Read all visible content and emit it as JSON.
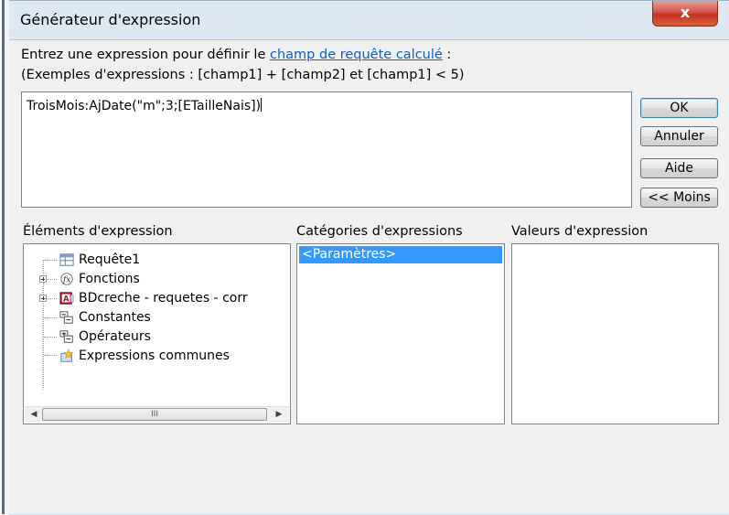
{
  "window": {
    "title": "Générateur d'expression",
    "close_symbol": "x"
  },
  "instructions": {
    "line1_prefix": "Entrez une expression pour définir le ",
    "line1_link": "champ de requête calculé",
    "line1_suffix": " :",
    "line2": "(Exemples d'expressions : [champ1] + [champ2] et [champ1] < 5)"
  },
  "expression": {
    "value": "TroisMois:AjDate(\"m\";3;[ETailleNais])"
  },
  "buttons": {
    "ok": "OK",
    "cancel": "Annuler",
    "help": "Aide",
    "less": "<< Moins"
  },
  "elements": {
    "label": "Éléments d'expression",
    "items": [
      {
        "label": "Requête1",
        "icon": "query-icon",
        "expandable": false
      },
      {
        "label": "Fonctions",
        "icon": "function-icon",
        "expandable": true
      },
      {
        "label": "BDcreche - requetes - corr",
        "icon": "database-icon",
        "expandable": true
      },
      {
        "label": "Constantes",
        "icon": "constants-icon",
        "expandable": false
      },
      {
        "label": "Opérateurs",
        "icon": "operators-icon",
        "expandable": false
      },
      {
        "label": "Expressions communes",
        "icon": "common-expressions-icon",
        "expandable": false
      }
    ],
    "scroll_thumb_glyph": "III"
  },
  "categories": {
    "label": "Catégories d'expressions",
    "items": [
      "<Paramètres>"
    ],
    "selected": "<Paramètres>"
  },
  "values": {
    "label": "Valeurs d'expression",
    "items": []
  },
  "colors": {
    "selection": "#3399ff",
    "link": "#0b5fc9",
    "close_button": "#c43222"
  }
}
